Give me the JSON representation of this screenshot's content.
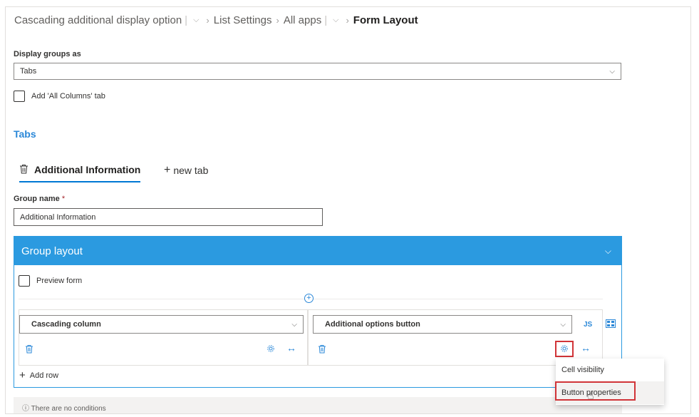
{
  "breadcrumb": {
    "site": "Cascading additional display option",
    "list_settings": "List Settings",
    "all_apps": "All apps",
    "current": "Form Layout"
  },
  "display_groups": {
    "label": "Display groups as",
    "value": "Tabs"
  },
  "all_columns_tab": {
    "label": "Add 'All Columns' tab",
    "checked": false
  },
  "tabs_section": {
    "title": "Tabs",
    "active_tab": "Additional Information",
    "new_tab": "new tab"
  },
  "group_name": {
    "label": "Group name",
    "required_mark": "*",
    "value": "Additional Information"
  },
  "group_layout": {
    "title": "Group layout",
    "preview_label": "Preview form",
    "cells": [
      {
        "field": "Cascading column"
      },
      {
        "field": "Additional options button",
        "js_label": "JS"
      }
    ],
    "add_row": "Add row"
  },
  "conditions": {
    "text": "There are no conditions"
  },
  "context_menu": {
    "items": [
      "Cell visibility",
      "Button properties"
    ]
  },
  "colors": {
    "accent": "#2b9ae0",
    "link": "#2b88d8",
    "highlight": "#d13438"
  }
}
